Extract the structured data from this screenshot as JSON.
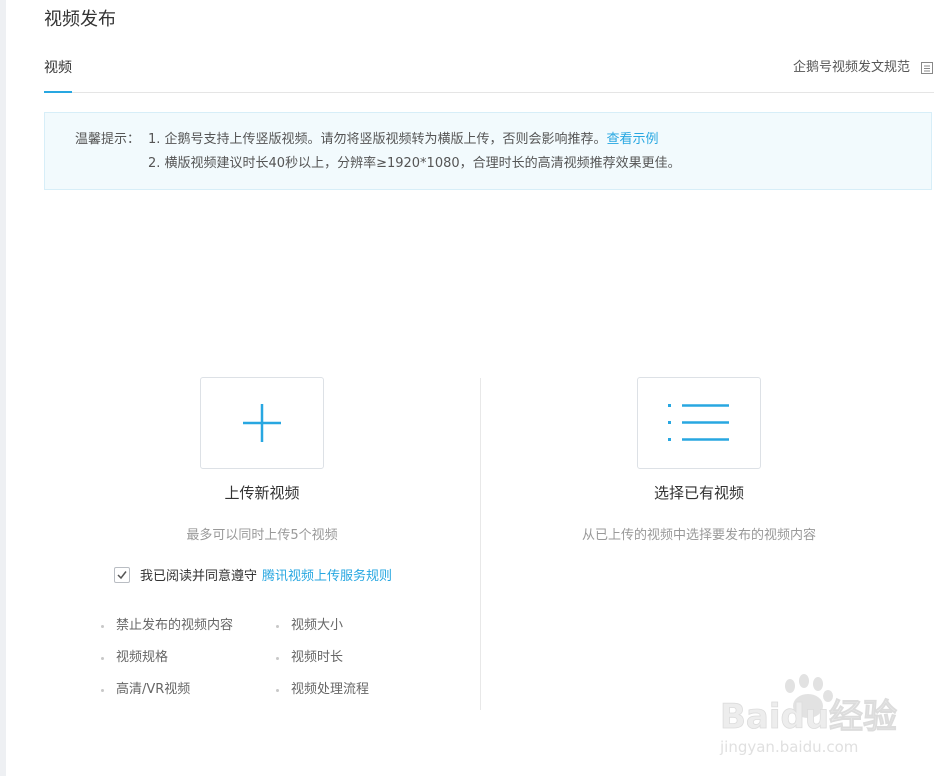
{
  "page": {
    "title": "视频发布"
  },
  "tabs": {
    "video_label": "视频",
    "spec_link": "企鹅号视频发文规范"
  },
  "notice": {
    "label": "温馨提示：",
    "line1_text": "1. 企鹅号支持上传竖版视频。请勿将竖版视频转为横版上传，否则会影响推荐。",
    "line1_link": "查看示例",
    "line2_text": "2. 横版视频建议时长40秒以上，分辨率≥1920*1080，合理时长的高清视频推荐效果更佳。"
  },
  "upload": {
    "title": "上传新视频",
    "desc": "最多可以同时上传5个视频",
    "agree_text": "我已阅读并同意遵守",
    "agree_link": "腾讯视频上传服务规则",
    "agree_checked": true
  },
  "existing": {
    "title": "选择已有视频",
    "desc": "从已上传的视频中选择要发布的视频内容"
  },
  "rules": {
    "col1": [
      "禁止发布的视频内容",
      "视频规格",
      "高清/VR视频"
    ],
    "col2": [
      "视频大小",
      "视频时长",
      "视频处理流程"
    ]
  },
  "watermark": {
    "brand": "Baidu经验",
    "url": "jingyan.baidu.com"
  },
  "colors": {
    "accent": "#28a7e1",
    "notice_bg": "#f2fafd",
    "border": "#dde1e6"
  },
  "icons": {
    "upload": "plus-icon",
    "existing": "list-icon",
    "spec": "document-icon",
    "checkbox": "checkmark-icon",
    "watermark": "baidu-paw-logo"
  }
}
